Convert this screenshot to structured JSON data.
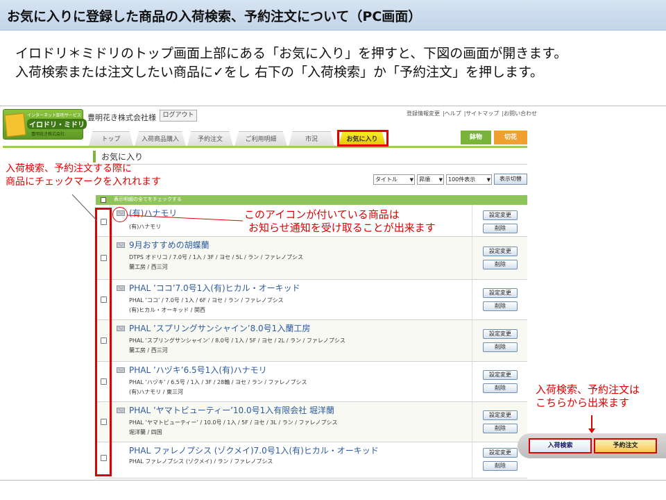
{
  "slide": {
    "title": "お気に入りに登録した商品の入荷検索、予約注文について（PC画面）",
    "intro_line1": "イロドリ＊ミドリのトップ画面上部にある「お気に入り」を押すと、下図の画面が開きます。",
    "intro_line2": "入荷検索または注文したい商品に✓をし 右下の「入荷検索」か「予約注文」を押します。"
  },
  "site": {
    "logo_small": "インターネット卸売サービス",
    "logo_main": "イロドリ・ミドリ",
    "logo_company": "豊明花き株式会社",
    "customer_name": "豊明花き株式会社様",
    "logout_label": "ログアウト",
    "top_links": [
      "登録情報変更",
      "|ヘルプ",
      "|サイトマップ",
      "|お問い合わせ"
    ]
  },
  "tabs": [
    {
      "label": "トップ",
      "active": false
    },
    {
      "label": "入荷商品購入",
      "active": false
    },
    {
      "label": "予約注文",
      "active": false
    },
    {
      "label": "ご利用明細",
      "active": false
    },
    {
      "label": "市況",
      "active": false
    },
    {
      "label": "お気に入り",
      "active": true
    }
  ],
  "category_tabs": [
    {
      "label": "鉢物",
      "color": "#7ab339"
    },
    {
      "label": "切花",
      "color": "#f0a030"
    }
  ],
  "page_heading": "お気に入り",
  "controls": {
    "sort_field": "タイトル",
    "sort_order": "昇順",
    "per_page": "100件表示",
    "switch_label": "表示切替"
  },
  "list_header": {
    "select_all_label": "表示明細の全てをチェックする"
  },
  "buttons": {
    "settings": "設定変更",
    "delete": "削除"
  },
  "items": [
    {
      "name": "(有)ハナモリ",
      "d1": "(有)ハナモリ",
      "d2": "",
      "icon": "mail-icon"
    },
    {
      "name": "9月おすすめの胡蝶蘭",
      "d1": "DTPS オドリコ / 7.0号 / 1入 / 3F / ヨセ / 5L / ラン / ファレノプシス",
      "d2": "蘭工房 / 西三河",
      "icon": "mail-icon"
    },
    {
      "name": "PHAL ’ココ’7.0号1入(有)ヒカル・オーキッド",
      "d1": "PHAL ’ココ’ / 7.0号 / 1入 / 6F / ヨセ / ラン / ファレノプシス",
      "d2": "(有)ヒカル・オーキッド / 関西",
      "icon": "mail-icon"
    },
    {
      "name": "PHAL ’スプリングサンシャイン’8.0号1入蘭工房",
      "d1": "PHAL ’スプリングサンシャイン’ / 8.0号 / 1入 / 5F / ヨセ / 2L / ラン / ファレノプシス",
      "d2": "蘭工房 / 西三河",
      "icon": "mail-icon"
    },
    {
      "name": "PHAL ’ハヅキ’6.5号1入(有)ハナモリ",
      "d1": "PHAL ’ハヅキ’ / 6.5号 / 1入 / 3F / 28輪 / ヨセ / ラン / ファレノプシス",
      "d2": "(有)ハナモリ / 東三河",
      "icon": "mail-icon"
    },
    {
      "name": "PHAL ’ヤマトビューティー’10.0号1入有限会社 堀洋蘭",
      "d1": "PHAL ’ヤマトビューティー’ / 10.0号 / 1入 / 5F / ヨセ / 3L / ラン / ファレノプシス",
      "d2": "堀洋蘭 / 四国",
      "icon": "mail-icon"
    },
    {
      "name": "PHAL ファレノプシス (ゾクメイ)7.0号1入(有)ヒカル・オーキッド",
      "d1": "PHAL ファレノプシス (ゾクメイ) / ラン / ファレノプシス",
      "d2": "",
      "icon": ""
    }
  ],
  "annotations": {
    "checkbox_note_1": "入荷検索、予約注文する際に",
    "checkbox_note_2": "商品にチェックマークを入れれます",
    "icon_note_1": "このアイコンが付いている商品は",
    "icon_note_2": "お知らせ通知を受け取ることが出来ます",
    "button_note_1": "入荷検索、予約注文は",
    "button_note_2": "こちらから出来ます"
  },
  "actions": {
    "arrival_search": "入荷検索",
    "reserve_order": "予約注文"
  },
  "colors": {
    "annotation_red": "#e00000",
    "tab_active": "#f0d000",
    "header_green": "#8fc45a",
    "link_blue": "#2c5aa0"
  }
}
